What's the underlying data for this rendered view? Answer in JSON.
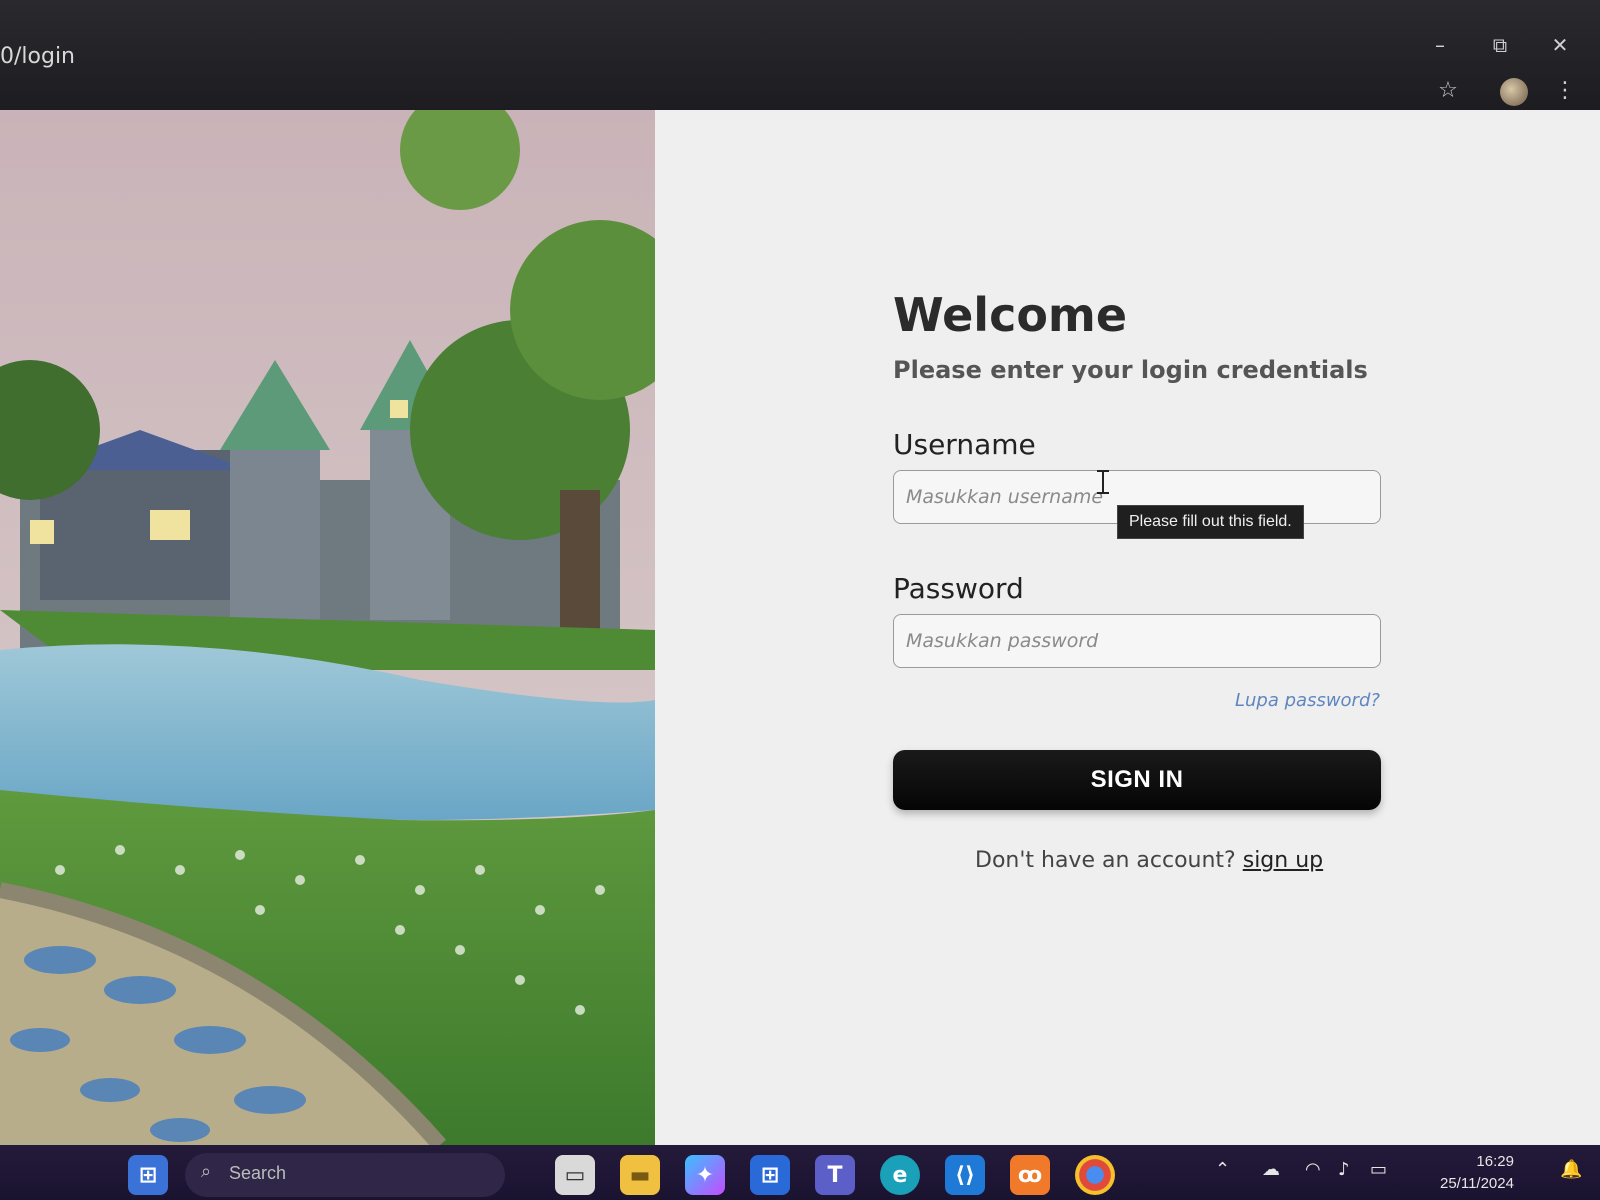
{
  "browser": {
    "url": "0/login",
    "star_icon": "star-icon",
    "menu_icon": "kebab-menu-icon"
  },
  "window_controls": {
    "minimize": "–",
    "restore": "⧉",
    "close": "✕"
  },
  "login": {
    "title": "Welcome",
    "subtitle": "Please enter your login credentials",
    "username_label": "Username",
    "username_placeholder": "Masukkan username",
    "username_value": "",
    "validation_tooltip": "Please fill out this field.",
    "password_label": "Password",
    "password_placeholder": "Masukkan password",
    "password_value": "",
    "forgot_link": "Lupa password?",
    "signin_button": "SIGN IN",
    "signup_prompt": "Don't have an account?",
    "signup_link": "sign up"
  },
  "taskbar": {
    "search_placeholder": "Search",
    "apps": [
      "windows-start-icon",
      "task-view-icon",
      "file-explorer-icon",
      "copilot-icon",
      "microsoft-store-icon",
      "teams-icon",
      "edge-icon",
      "vscode-icon",
      "xampp-icon",
      "chrome-icon"
    ],
    "time": "16:29",
    "date": "25/11/2024"
  },
  "colors": {
    "accent_link": "#5f86c0",
    "button_bg": "#0a0a0a",
    "taskbar_bg": "#1f1634"
  }
}
